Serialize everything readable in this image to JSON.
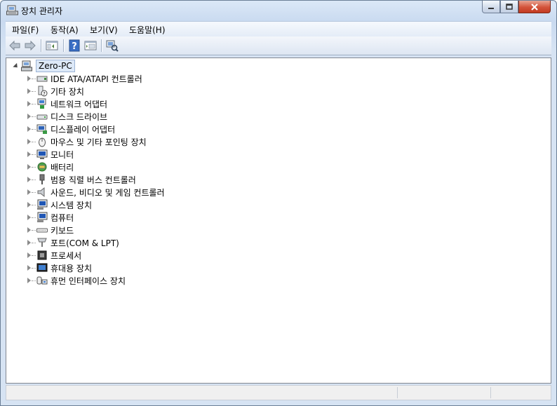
{
  "window": {
    "title": "장치 관리자"
  },
  "menu": [
    "파일(F)",
    "동작(A)",
    "보기(V)",
    "도움말(H)"
  ],
  "toolbar": [
    "back-icon",
    "forward-icon",
    "show-hide-console-tree-icon",
    "help-icon",
    "properties-icon",
    "scan-hardware-icon"
  ],
  "tree": {
    "root": "Zero-PC",
    "items": [
      "IDE ATA/ATAPI 컨트롤러",
      "기타 장치",
      "네트워크 어댑터",
      "디스크 드라이브",
      "디스플레이 어댑터",
      "마우스 및 기타 포인팅 장치",
      "모니터",
      "배터리",
      "범용 직렬 버스 컨트롤러",
      "사운드, 비디오 및 게임 컨트롤러",
      "시스템 장치",
      "컴퓨터",
      "키보드",
      "포트(COM & LPT)",
      "프로세서",
      "휴대용 장치",
      "휴먼 인터페이스 장치"
    ]
  }
}
